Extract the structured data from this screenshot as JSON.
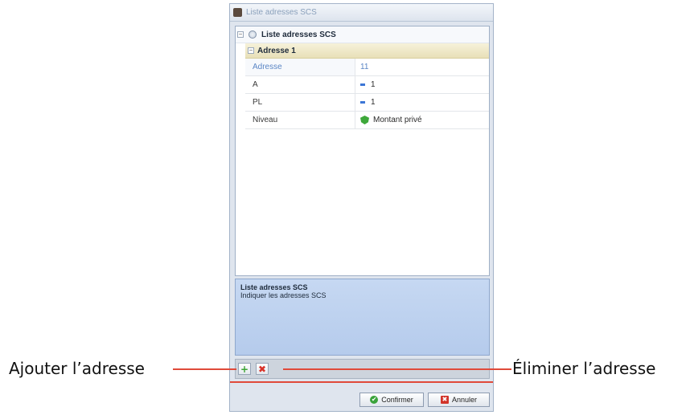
{
  "window": {
    "title": "Liste adresses SCS"
  },
  "grid": {
    "root_label": "Liste adresses SCS",
    "group_label": "Adresse 1",
    "rows": [
      {
        "name": "Adresse",
        "value": "11"
      },
      {
        "name": "A",
        "value": "1"
      },
      {
        "name": "PL",
        "value": "1"
      },
      {
        "name": "Niveau",
        "value": "Montant privé"
      }
    ]
  },
  "description": {
    "title": "Liste adresses SCS",
    "text": "Indiquer les adresses SCS"
  },
  "buttons": {
    "add_glyph": "+",
    "delete_glyph": "✖",
    "confirm": "Confirmer",
    "cancel": "Annuler"
  },
  "annotations": {
    "left": "Ajouter l’adresse",
    "right": "Éliminer l’adresse"
  },
  "colors": {
    "accent_red": "#e04a3a",
    "selected_text": "#5b86c5",
    "add_green": "#3ca434",
    "delete_red": "#d8332a"
  }
}
